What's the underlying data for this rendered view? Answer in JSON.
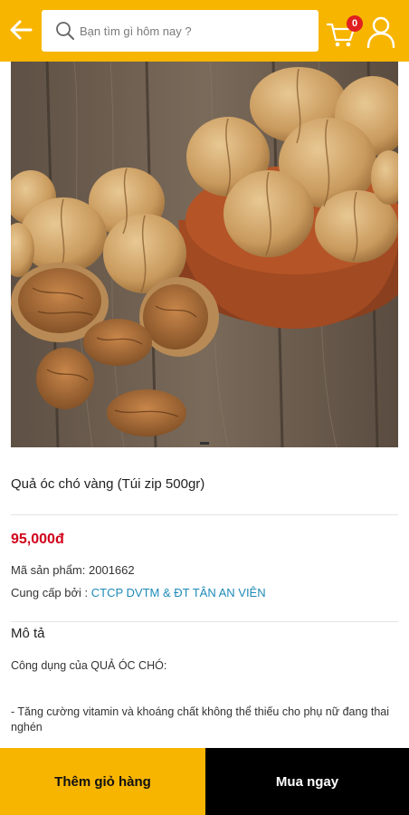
{
  "header": {
    "back_icon": "arrow-left-icon",
    "search_placeholder": "Bạn tìm gì hôm nay ?",
    "search_icon": "search-icon",
    "cart_icon": "cart-icon",
    "cart_count": "0",
    "user_icon": "user-icon",
    "background_color": "#f7b500"
  },
  "product": {
    "image_description_icon": "walnuts-photo",
    "title": "Quả óc chó vàng (Túi zip 500gr)",
    "price": "95,000đ",
    "price_color": "#d0021b",
    "sku_label": "Mã sản phẩm: ",
    "sku_value": "2001662",
    "supplier_label": "Cung cấp bởi : ",
    "supplier_name": "CTCP DVTM & ĐT TÂN AN VIÊN",
    "supplier_color": "#1e8ab8"
  },
  "description": {
    "heading": "Mô tả",
    "paragraph_1": "Công dụng của QUẢ ÓC CHÓ:",
    "paragraph_2": "- Tăng cường vitamin và khoáng chất không thể thiếu cho phụ nữ đang thai nghén"
  },
  "actions": {
    "add_to_cart": "Thêm giỏ hàng",
    "buy_now": "Mua ngay"
  }
}
